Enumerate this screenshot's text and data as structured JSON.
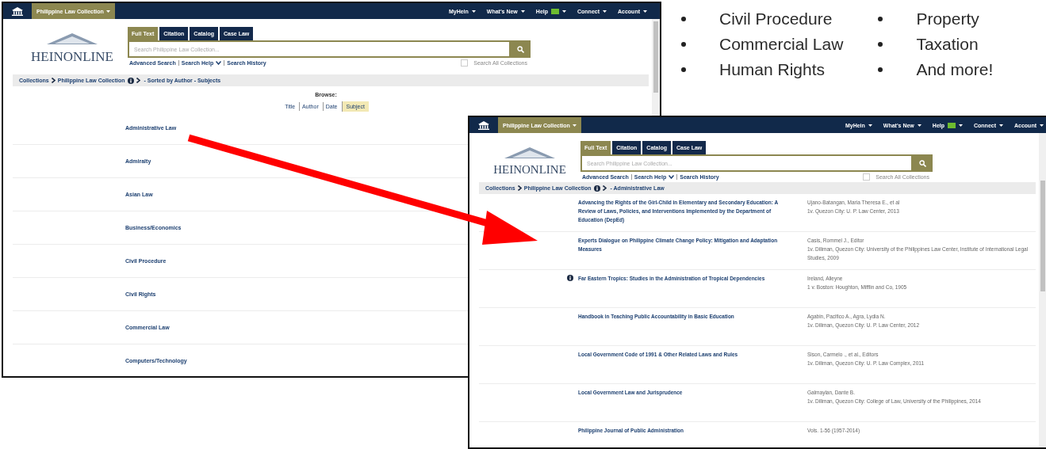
{
  "bullets": {
    "column_1": [
      "Civil Procedure",
      "Commercial Law",
      "Human Rights"
    ],
    "column_2": [
      "Property",
      "Taxation",
      "And more!"
    ]
  },
  "browse_window": {
    "collection_menu": "Philippine Law Collection",
    "nav": [
      "MyHein",
      "What's New",
      "Help",
      "Connect",
      "Account"
    ],
    "logo": "HEINONLINE",
    "search_tabs": [
      {
        "label": "Full Text",
        "selected": true
      },
      {
        "label": "Citation",
        "selected": false
      },
      {
        "label": "Catalog",
        "selected": false
      },
      {
        "label": "Case Law",
        "selected": false
      }
    ],
    "search": {
      "placeholder": "Search Philippine Law Collection..."
    },
    "search_links": [
      "Advanced Search",
      "Search Help",
      "Search History"
    ],
    "search_all": {
      "label": "Search All Collections",
      "checked": false
    },
    "breadcrumb": [
      "Collections",
      "Philippine Law Collection"
    ],
    "breadcrumb_current": "- Sorted by Author - Subjects",
    "browse_label": "Browse:",
    "browse_options": [
      {
        "label": "Title",
        "selected": false
      },
      {
        "label": "Author",
        "selected": false
      },
      {
        "label": "Date",
        "selected": false
      },
      {
        "label": "Subject",
        "selected": true
      }
    ],
    "subjects": [
      "Administrative Law",
      "Admiralty",
      "Asian Law",
      "Business/Economics",
      "Civil Procedure",
      "Civil Rights",
      "Commercial Law",
      "Computers/Technology"
    ]
  },
  "results_window": {
    "collection_menu": "Philippine Law Collection",
    "nav": [
      "MyHein",
      "What's New",
      "Help",
      "Connect",
      "Account"
    ],
    "logo": "HEINONLINE",
    "search_tabs": [
      {
        "label": "Full Text",
        "selected": true
      },
      {
        "label": "Citation",
        "selected": false
      },
      {
        "label": "Catalog",
        "selected": false
      },
      {
        "label": "Case Law",
        "selected": false
      }
    ],
    "search": {
      "placeholder": "Search Philippine Law Collection..."
    },
    "search_links": [
      "Advanced Search",
      "Search Help",
      "Search History"
    ],
    "search_all": {
      "label": "Search All Collections",
      "checked": false
    },
    "breadcrumb": [
      "Collections",
      "Philippine Law Collection"
    ],
    "breadcrumb_current": "- Administrative Law",
    "results": [
      {
        "info": false,
        "title": "Advancing the Rights of the Girl-Child in Elementary and Secondary Education: A Review of Laws, Policies, and Interventions Implemented by the Department of Education (DepEd)",
        "author": "Ujano-Batangan, Maria Theresa E., et al",
        "publication": "1v. Quezon City: U. P. Law Center, 2013"
      },
      {
        "info": false,
        "title": "Experts Dialogue on Philippine Climate Change Policy: Mitigation and Adaptation Measures",
        "author": "Casis, Rommel J., Editor",
        "publication": "1v. Diliman, Quezon City: University of the Philippines Law Center, Institute of International Legal Studies, 2009"
      },
      {
        "info": true,
        "title": "Far Eastern Tropics: Studies in the Administration of Tropical Dependencies",
        "author": "Ireland, Alleyne",
        "publication": "1 v. Boston: Houghton, Mifflin and Co, 1905"
      },
      {
        "info": false,
        "title": "Handbook in Teaching Public Accountability in Basic Education",
        "author": "Agabin, Pacifico A., Agra, Lydia N.",
        "publication": "1v. Diliman, Quezon City: U. P. Law Center, 2012"
      },
      {
        "info": false,
        "title": "Local Government Code of 1991 & Other Related Laws and Rules",
        "author": "Sison, Carmelo ., et al., Editors",
        "publication": "1v. Diliman, Quezon City: U. P. Law Complex, 2011"
      },
      {
        "info": false,
        "title": "Local Government Law and Jurisprudence",
        "author": "Galmaylan, Dante B.",
        "publication": "1v. Diliman, Quezon City: College of Law, University of the Philippines, 2014"
      },
      {
        "info": false,
        "title": "Philippine Journal of Public Administration",
        "author": "Vols. 1-56 (1957-2014)"
      }
    ]
  }
}
